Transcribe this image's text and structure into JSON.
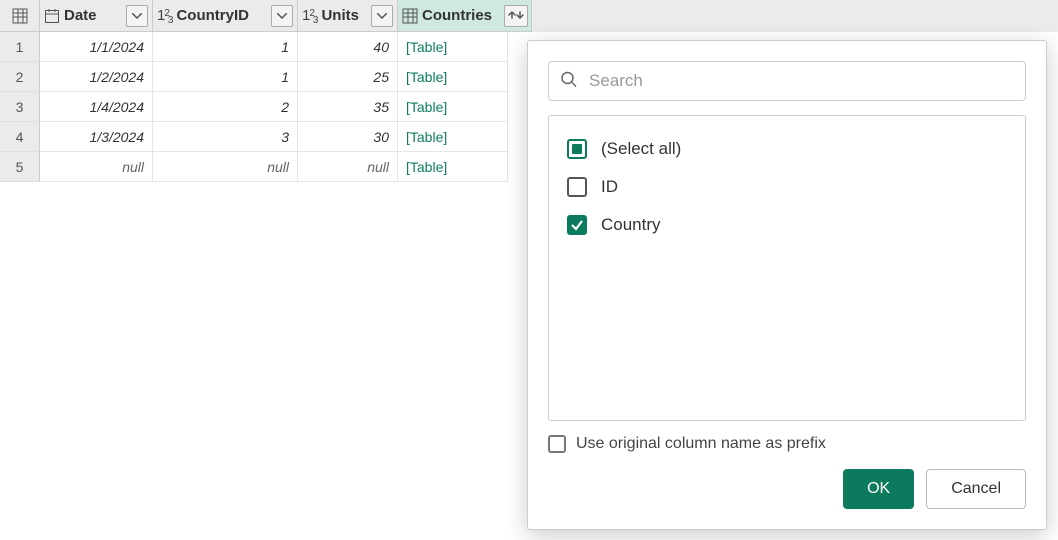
{
  "columns": {
    "date": "Date",
    "country_id": "CountryID",
    "units": "Units",
    "countries": "Countries"
  },
  "rows": [
    {
      "idx": "1",
      "date": "1/1/2024",
      "cid": "1",
      "units": "40",
      "countries": "[Table]"
    },
    {
      "idx": "2",
      "date": "1/2/2024",
      "cid": "1",
      "units": "25",
      "countries": "[Table]"
    },
    {
      "idx": "3",
      "date": "1/4/2024",
      "cid": "2",
      "units": "35",
      "countries": "[Table]"
    },
    {
      "idx": "4",
      "date": "1/3/2024",
      "cid": "3",
      "units": "30",
      "countries": "[Table]"
    },
    {
      "idx": "5",
      "date": "null",
      "cid": "null",
      "units": "null",
      "countries": "[Table]"
    }
  ],
  "panel": {
    "search_placeholder": "Search",
    "select_all": "(Select all)",
    "items": [
      {
        "label": "ID",
        "checked": false
      },
      {
        "label": "Country",
        "checked": true
      }
    ],
    "prefix_label": "Use original column name as prefix",
    "ok": "OK",
    "cancel": "Cancel"
  }
}
